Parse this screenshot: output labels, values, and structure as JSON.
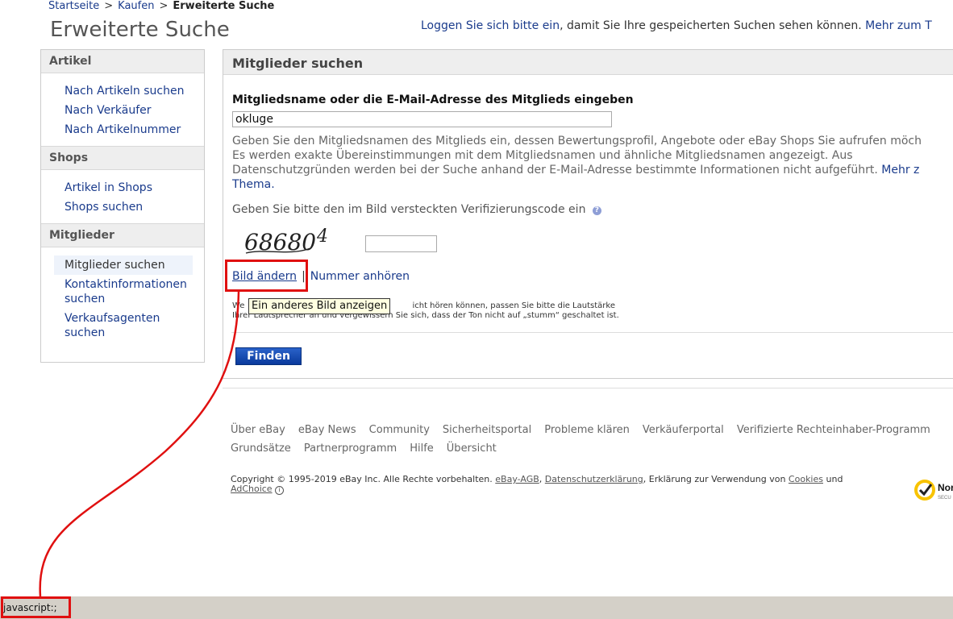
{
  "breadcrumb": {
    "items": [
      "Startseite",
      "Kaufen"
    ],
    "separator": ">",
    "current": "Erweiterte Suche"
  },
  "header": {
    "title": "Erweiterte Suche",
    "login_link": "Loggen Sie sich bitte ein",
    "login_text": ", damit Sie Ihre gespeicherten Suchen sehen können.",
    "more_link": "Mehr zum T"
  },
  "sidebar": {
    "sections": [
      {
        "heading": "Artikel",
        "items": [
          "Nach Artikeln suchen",
          "Nach Verkäufer",
          "Nach Artikelnummer"
        ]
      },
      {
        "heading": "Shops",
        "items": [
          "Artikel in Shops",
          "Shops suchen"
        ]
      },
      {
        "heading": "Mitglieder",
        "items": [
          "Mitglieder suchen",
          "Kontaktinformationen suchen",
          "Verkaufsagenten suchen"
        ]
      }
    ]
  },
  "main": {
    "heading": "Mitglieder suchen",
    "field_label": "Mitgliedsname oder die E-Mail-Adresse des Mitglieds eingeben",
    "member_input_value": "okluge",
    "help_line1": "Geben Sie den Mitgliedsnamen des Mitglieds ein, dessen Bewertungsprofil, Angebote oder eBay Shops Sie aufrufen möch",
    "help_line2": "Es werden exakte Übereinstimmungen mit dem Mitgliedsnamen und ähnliche Mitgliedsnamen angezeigt. Aus",
    "help_line3": "Datenschutzgründen werden bei der Suche anhand der E-Mail-Adresse bestimmte Informationen nicht aufgeführt.",
    "help_more_link": "Mehr z",
    "help_topic_link": "Thema.",
    "captcha_prompt": "Geben Sie bitte den im Bild versteckten Verifizierungscode ein",
    "captcha_code": "68680",
    "captcha_extra": "4",
    "change_image_link": "Bild ändern",
    "link_separator": "|",
    "listen_link": "Nummer anhören",
    "audio_note_line1_start": "We",
    "audio_note_line1_end": "icht hören können, passen Sie bitte die Lautstärke",
    "audio_note_line2": "Ihrer Lautsprecher an und vergewissern Sie sich, dass der Ton nicht auf „stumm“ geschaltet ist.",
    "tooltip": "Ein anderes Bild anzeigen",
    "find_button": "Finden"
  },
  "footer": {
    "links": [
      "Über eBay",
      "eBay News",
      "Community",
      "Sicherheitsportal",
      "Probleme klären",
      "Verkäuferportal",
      "Verifizierte Rechteinhaber-Programm",
      "Grundsätze",
      "Partnerprogramm",
      "Hilfe",
      "Übersicht"
    ],
    "copyright_text": "Copyright © 1995-2019 eBay Inc. Alle Rechte vorbehalten.",
    "agb_link": "eBay-AGB",
    "privacy_link": "Datenschutzerklärung",
    "cookies_text": ", Erklärung zur Verwendung von",
    "cookies_link": "Cookies",
    "and_text": "und",
    "adchoice_link": "AdChoice",
    "seal_text": "Nor",
    "seal_subtext": "SECU"
  },
  "status_bar": {
    "text": "javascript:;"
  },
  "colors": {
    "link": "#1a3b8c",
    "button": "#0a3a9c",
    "annotation": "#e01010",
    "tooltip_bg": "#ffffe1",
    "status_bar": "#d4d0c8"
  },
  "icons": [
    "info-icon",
    "adchoice-icon",
    "norton-seal-icon"
  ]
}
